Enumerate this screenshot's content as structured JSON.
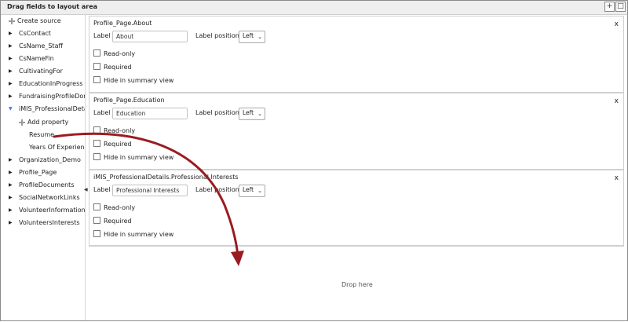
{
  "window": {
    "title": "Drag fields to layout area",
    "add_button": "+",
    "restore_button": "□"
  },
  "sidebar": {
    "create_source": "Create source",
    "items": [
      {
        "label": "CsContact"
      },
      {
        "label": "CsName_Staff"
      },
      {
        "label": "CsNameFin"
      },
      {
        "label": "CultivatingFor"
      },
      {
        "label": "EducationInProgress"
      },
      {
        "label": "FundraisingProfileDonor"
      },
      {
        "label": "iMIS_ProfessionalDetails"
      },
      {
        "label": "Organization_Demo"
      },
      {
        "label": "Profile_Page"
      },
      {
        "label": "ProfileDocuments"
      },
      {
        "label": "SocialNetworkLinks"
      },
      {
        "label": "VolunteerInformation"
      },
      {
        "label": "VolunteersInterests"
      }
    ],
    "expanded": {
      "add_property": "Add property",
      "children": [
        "Resume",
        "Years Of Experience"
      ]
    }
  },
  "cards": [
    {
      "title": "Profile_Page.About",
      "label_text": "Label",
      "label_value": "About",
      "position_text": "Label position",
      "position_value": "Left",
      "readonly": "Read-only",
      "required": "Required",
      "hide": "Hide in summary view",
      "close": "x"
    },
    {
      "title": "Profile_Page.Education",
      "label_text": "Label",
      "label_value": "Education",
      "position_text": "Label position",
      "position_value": "Left",
      "readonly": "Read-only",
      "required": "Required",
      "hide": "Hide in summary view",
      "close": "x"
    },
    {
      "title": "iMIS_ProfessionalDetails.Professional Interests",
      "label_text": "Label",
      "label_value": "Professional Interests",
      "position_text": "Label position",
      "position_value": "Left",
      "readonly": "Read-only",
      "required": "Required",
      "hide": "Hide in summary view",
      "close": "x"
    }
  ],
  "dropzone": {
    "text": "Drop here"
  },
  "colors": {
    "annotation_arrow": "#9b1b1f",
    "expanded_triangle": "#3a7bd5"
  }
}
